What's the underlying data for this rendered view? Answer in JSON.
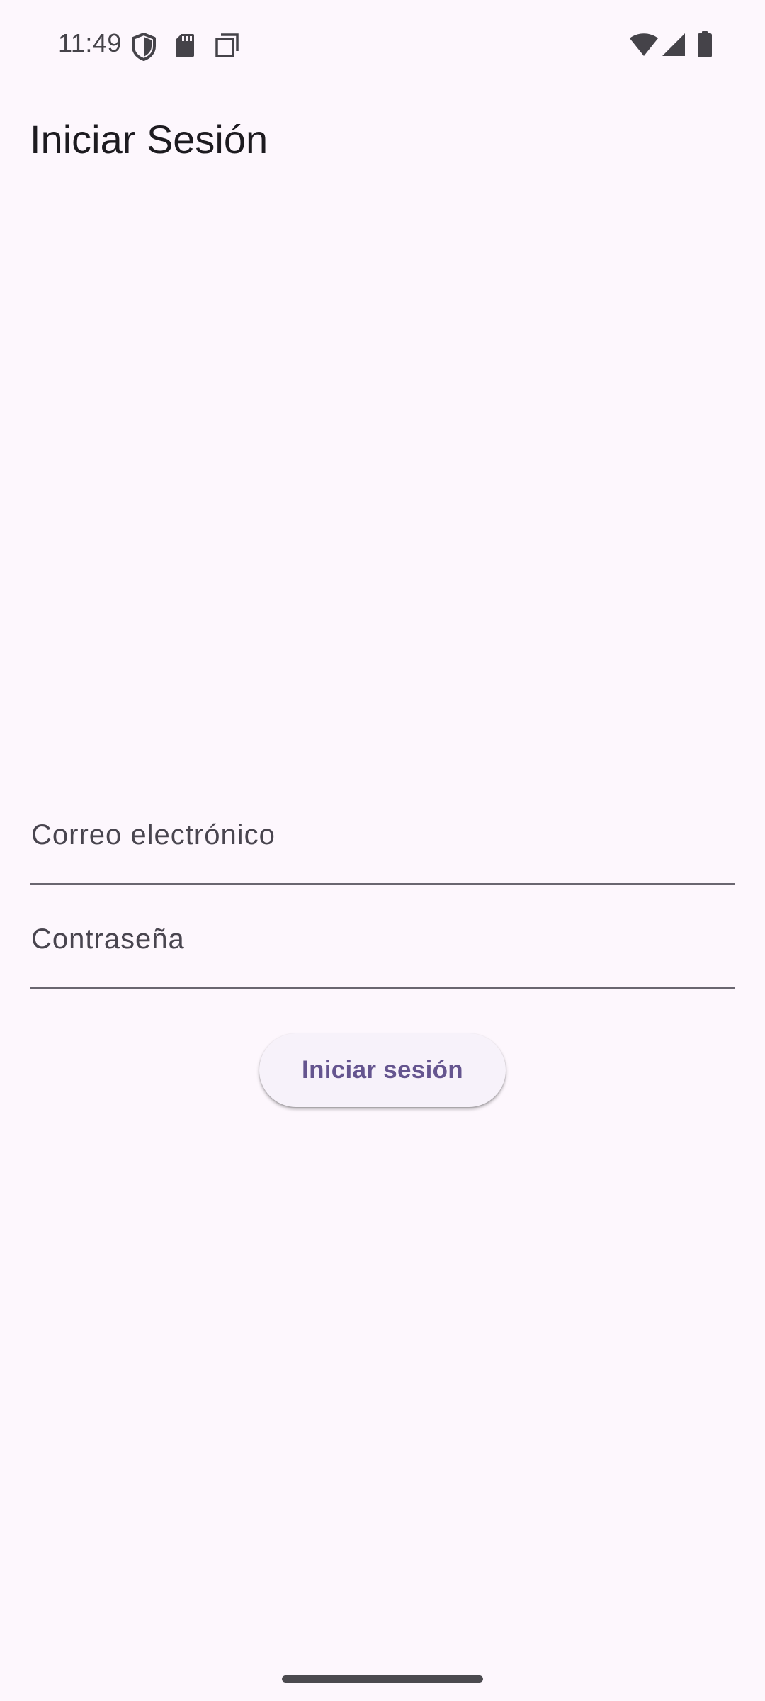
{
  "status_bar": {
    "time": "11:49",
    "left_icons": [
      "shield-icon",
      "sd-card-icon",
      "screenshot-icon"
    ],
    "right_icons": [
      "wifi-icon",
      "cellular-signal-icon",
      "battery-icon"
    ]
  },
  "app_bar": {
    "title": "Iniciar Sesión"
  },
  "form": {
    "email": {
      "label": "Correo electrónico",
      "value": ""
    },
    "password": {
      "label": "Contraseña",
      "value": ""
    },
    "submit_label": "Iniciar sesión"
  },
  "colors": {
    "background": "#fdf7fd",
    "button_background": "#f7f2fa",
    "button_text": "#65558f",
    "underline": "#6a6670"
  }
}
